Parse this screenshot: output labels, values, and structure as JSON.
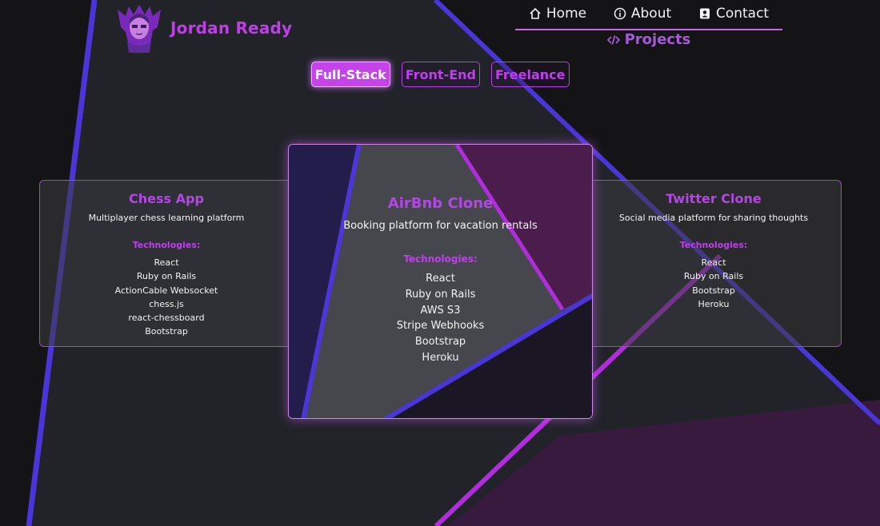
{
  "brand": {
    "name": "Jordan Ready",
    "accent_color": "#c03de8"
  },
  "nav": {
    "items": [
      {
        "label": "Home",
        "icon": "home-icon"
      },
      {
        "label": "About",
        "icon": "info-icon"
      },
      {
        "label": "Contact",
        "icon": "contact-card-icon"
      }
    ],
    "active": {
      "label": "Projects",
      "icon": "code-icon"
    }
  },
  "filters": [
    {
      "label": "Full-Stack",
      "active": true
    },
    {
      "label": "Front-End",
      "active": false
    },
    {
      "label": "Freelance",
      "active": false
    }
  ],
  "projects": [
    {
      "title": "Chess App",
      "description": "Multiplayer chess learning platform",
      "tech_heading": "Technologies:",
      "technologies": [
        "React",
        "Ruby on Rails",
        "ActionCable Websocket",
        "chess.js",
        "react-chessboard",
        "Bootstrap"
      ]
    },
    {
      "title": "AirBnb Clone",
      "description": "Booking platform for vacation rentals",
      "tech_heading": "Technologies:",
      "technologies": [
        "React",
        "Ruby on Rails",
        "AWS S3",
        "Stripe Webhooks",
        "Bootstrap",
        "Heroku"
      ]
    },
    {
      "title": "Twitter Clone",
      "description": "Social media platform for sharing thoughts",
      "tech_heading": "Technologies:",
      "technologies": [
        "React",
        "Ruby on Rails",
        "Bootstrap",
        "Heroku"
      ]
    }
  ]
}
